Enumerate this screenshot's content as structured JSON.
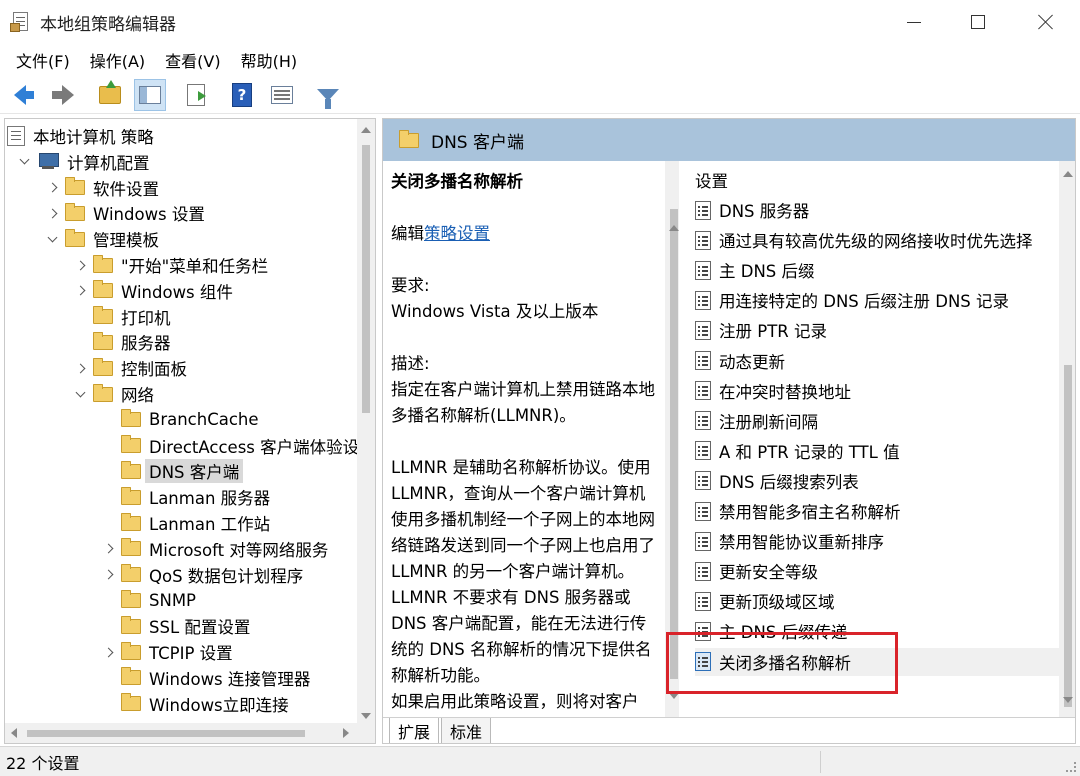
{
  "window": {
    "title": "本地组策略编辑器"
  },
  "menu": [
    "文件(F)",
    "操作(A)",
    "查看(V)",
    "帮助(H)"
  ],
  "tree": {
    "items": [
      {
        "label": "本地计算机 策略",
        "level": 0,
        "expand": "none",
        "icon": "policy-icon"
      },
      {
        "label": "计算机配置",
        "level": 1,
        "expand": "expanded",
        "icon": "computer-icon"
      },
      {
        "label": "软件设置",
        "level": 2,
        "expand": "collapsed",
        "icon": "folder-icon"
      },
      {
        "label": "Windows 设置",
        "level": 2,
        "expand": "collapsed",
        "icon": "folder-icon"
      },
      {
        "label": "管理模板",
        "level": 2,
        "expand": "expanded",
        "icon": "folder-icon"
      },
      {
        "label": "\"开始\"菜单和任务栏",
        "level": 3,
        "expand": "collapsed",
        "icon": "folder-icon"
      },
      {
        "label": "Windows 组件",
        "level": 3,
        "expand": "collapsed",
        "icon": "folder-icon"
      },
      {
        "label": "打印机",
        "level": 3,
        "expand": "none",
        "icon": "folder-icon"
      },
      {
        "label": "服务器",
        "level": 3,
        "expand": "none",
        "icon": "folder-icon"
      },
      {
        "label": "控制面板",
        "level": 3,
        "expand": "collapsed",
        "icon": "folder-icon"
      },
      {
        "label": "网络",
        "level": 3,
        "expand": "expanded",
        "icon": "folder-icon"
      },
      {
        "label": "BranchCache",
        "level": 4,
        "expand": "none",
        "icon": "folder-icon"
      },
      {
        "label": "DirectAccess 客户端体验设",
        "level": 4,
        "expand": "none",
        "icon": "folder-icon"
      },
      {
        "label": "DNS 客户端",
        "level": 4,
        "expand": "none",
        "icon": "folder-icon",
        "selected": true
      },
      {
        "label": "Lanman 服务器",
        "level": 4,
        "expand": "none",
        "icon": "folder-icon"
      },
      {
        "label": "Lanman 工作站",
        "level": 4,
        "expand": "none",
        "icon": "folder-icon"
      },
      {
        "label": "Microsoft 对等网络服务",
        "level": 4,
        "expand": "collapsed",
        "icon": "folder-icon"
      },
      {
        "label": "QoS 数据包计划程序",
        "level": 4,
        "expand": "collapsed",
        "icon": "folder-icon"
      },
      {
        "label": "SNMP",
        "level": 4,
        "expand": "none",
        "icon": "folder-icon"
      },
      {
        "label": "SSL 配置设置",
        "level": 4,
        "expand": "none",
        "icon": "folder-icon"
      },
      {
        "label": "TCPIP 设置",
        "level": 4,
        "expand": "collapsed",
        "icon": "folder-icon"
      },
      {
        "label": "Windows 连接管理器",
        "level": 4,
        "expand": "none",
        "icon": "folder-icon"
      },
      {
        "label": "Windows立即连接",
        "level": 4,
        "expand": "none",
        "icon": "folder-icon"
      }
    ]
  },
  "panel": {
    "header": "DNS 客户端",
    "description": {
      "title": "关闭多播名称解析",
      "edit_prefix": "编辑",
      "edit_link": "策略设置",
      "requirements_label": "要求:",
      "requirements_value": "Windows Vista 及以上版本",
      "description_label": "描述:",
      "paragraph1": "指定在客户端计算机上禁用链路本地多播名称解析(LLMNR)。",
      "paragraph2": "LLMNR 是辅助名称解析协议。使用 LLMNR，查询从一个客户端计算机使用多播机制经一个子网上的本地网络链路发送到同一个子网上也启用了 LLMNR 的另一个客户端计算机。LLMNR 不要求有 DNS 服务器或 DNS 客户端配置，能在无法进行传统的 DNS 名称解析的情况下提供名称解析功能。",
      "paragraph3": "如果启用此策略设置，则将对客户"
    },
    "settings": {
      "header": "设置",
      "items": [
        "DNS 服务器",
        "通过具有较高优先级的网络接收时优先选择",
        "主 DNS 后缀",
        "用连接特定的 DNS 后缀注册 DNS 记录",
        "注册 PTR 记录",
        "动态更新",
        "在冲突时替换地址",
        "注册刷新间隔",
        "A 和 PTR 记录的 TTL 值",
        "DNS 后缀搜索列表",
        "禁用智能多宿主名称解析",
        "禁用智能协议重新排序",
        "更新安全等级",
        "更新顶级域区域",
        "主 DNS 后缀传递",
        "关闭多播名称解析"
      ],
      "selected_index": 15
    },
    "tabs": [
      "扩展",
      "标准"
    ],
    "active_tab": 0
  },
  "status": {
    "text": "22 个设置"
  }
}
